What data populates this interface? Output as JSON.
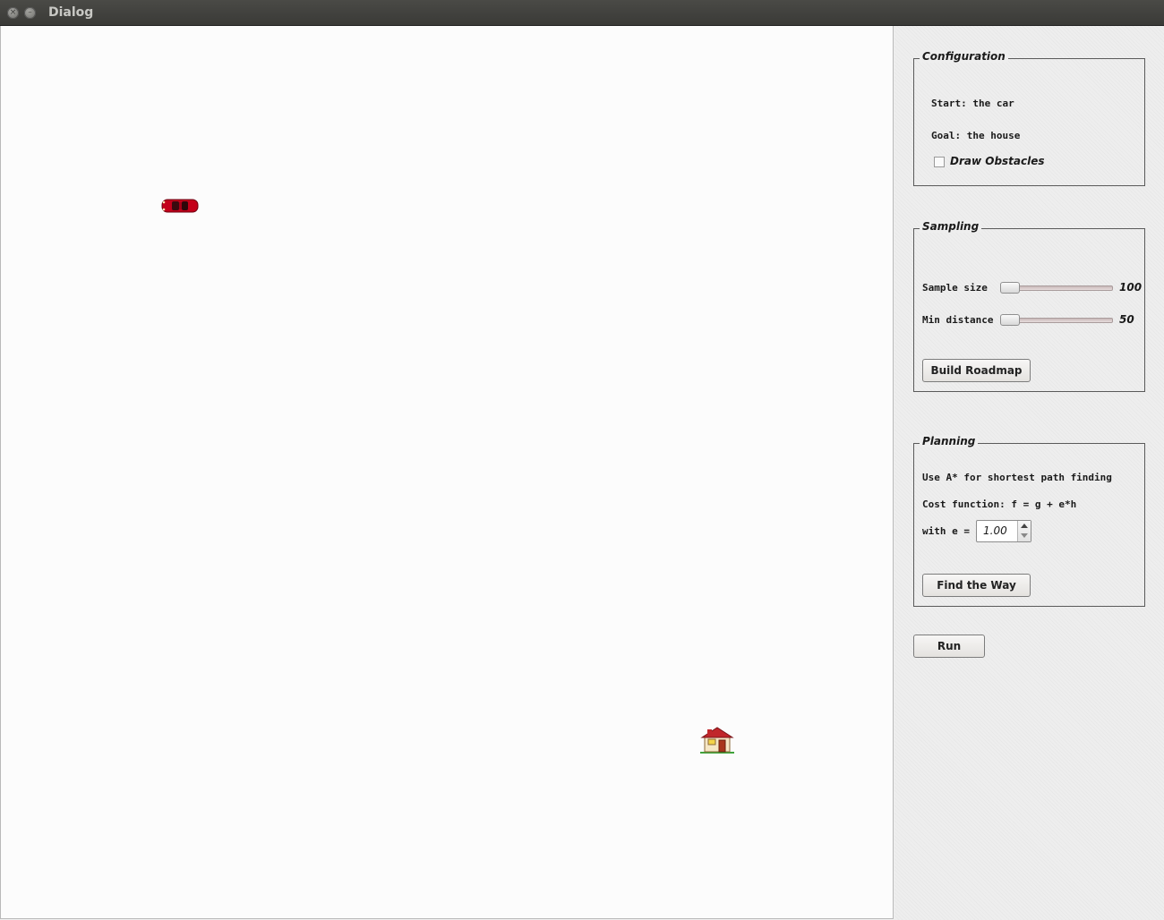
{
  "window": {
    "title": "Dialog"
  },
  "canvas": {
    "start_icon": "red-car-icon",
    "goal_icon": "house-icon"
  },
  "configuration": {
    "title": "Configuration",
    "start_label": "Start: the car",
    "goal_label": "Goal: the house",
    "draw_obstacles_label": "Draw Obstacles",
    "draw_obstacles_checked": false
  },
  "sampling": {
    "title": "Sampling",
    "sample_size_label": "Sample size",
    "sample_size_value": "100",
    "min_distance_label": "Min  distance",
    "min_distance_value": "50",
    "build_button": "Build Roadmap"
  },
  "planning": {
    "title": "Planning",
    "line1": "Use A* for shortest path finding",
    "line2": "Cost function: f = g + e*h",
    "with_label": "with e =",
    "e_value": "1.00",
    "find_button": "Find the Way"
  },
  "run_button": "Run",
  "colors": {
    "car": "#c4001a",
    "house_roof": "#c0262b",
    "panel_bg": "#eeeeee"
  }
}
